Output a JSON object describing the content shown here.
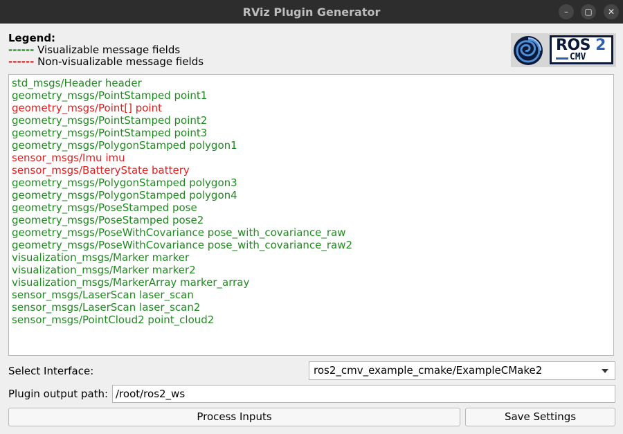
{
  "window": {
    "title": "RViz Plugin Generator",
    "controls": {
      "minimize": "–",
      "maximize": "▢",
      "close": "✕"
    }
  },
  "legend": {
    "title": "Legend:",
    "visualizable": {
      "dash": "------",
      "text": " Visualizable message fields",
      "color": "#1f8a1f"
    },
    "non_visualizable": {
      "dash": "------",
      "text": " Non-visualizable message fields",
      "color": "#e11d1d"
    }
  },
  "logo": {
    "ros": "ROS",
    "two": "2",
    "cmv": "CMV"
  },
  "fields": [
    {
      "text": "std_msgs/Header header",
      "visualizable": true
    },
    {
      "text": "geometry_msgs/PointStamped point1",
      "visualizable": true
    },
    {
      "text": "geometry_msgs/Point[] point",
      "visualizable": false
    },
    {
      "text": "geometry_msgs/PointStamped point2",
      "visualizable": true
    },
    {
      "text": "geometry_msgs/PointStamped point3",
      "visualizable": true
    },
    {
      "text": "geometry_msgs/PolygonStamped polygon1",
      "visualizable": true
    },
    {
      "text": "sensor_msgs/Imu imu",
      "visualizable": false
    },
    {
      "text": "sensor_msgs/BatteryState battery",
      "visualizable": false
    },
    {
      "text": "geometry_msgs/PolygonStamped polygon3",
      "visualizable": true
    },
    {
      "text": "geometry_msgs/PolygonStamped polygon4",
      "visualizable": true
    },
    {
      "text": "geometry_msgs/PoseStamped pose",
      "visualizable": true
    },
    {
      "text": "geometry_msgs/PoseStamped pose2",
      "visualizable": true
    },
    {
      "text": "geometry_msgs/PoseWithCovariance pose_with_covariance_raw",
      "visualizable": true
    },
    {
      "text": "geometry_msgs/PoseWithCovariance pose_with_covariance_raw2",
      "visualizable": true
    },
    {
      "text": "visualization_msgs/Marker marker",
      "visualizable": true
    },
    {
      "text": "visualization_msgs/Marker marker2",
      "visualizable": true
    },
    {
      "text": "visualization_msgs/MarkerArray marker_array",
      "visualizable": true
    },
    {
      "text": "sensor_msgs/LaserScan laser_scan",
      "visualizable": true
    },
    {
      "text": "sensor_msgs/LaserScan laser_scan2",
      "visualizable": true
    },
    {
      "text": "sensor_msgs/PointCloud2 point_cloud2",
      "visualizable": true
    }
  ],
  "interface": {
    "label": "Select Interface:",
    "selected": "ros2_cmv_example_cmake/ExampleCMake2"
  },
  "output_path": {
    "label": "Plugin output path:",
    "value": "/root/ros2_ws"
  },
  "buttons": {
    "process": "Process Inputs",
    "save": "Save Settings"
  }
}
